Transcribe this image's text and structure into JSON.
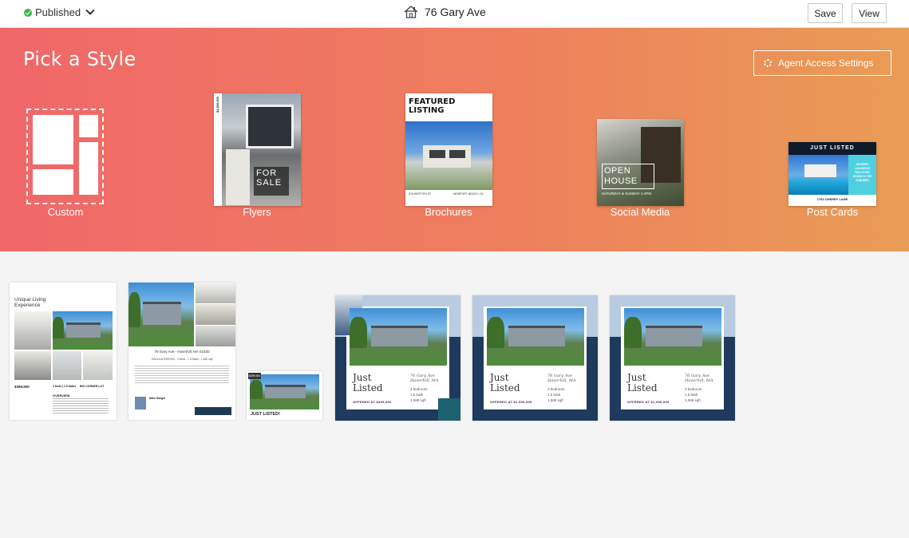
{
  "topbar": {
    "status": "Published",
    "title": "76 Gary Ave",
    "save_label": "Save",
    "view_label": "View"
  },
  "banner": {
    "heading": "Pick a Style",
    "agent_access_label": "Agent Access Settings",
    "styles": [
      {
        "label": "Custom"
      },
      {
        "label": "Flyers"
      },
      {
        "label": "Brochures"
      },
      {
        "label": "Social Media"
      },
      {
        "label": "Post Cards"
      }
    ],
    "flyer_thumb": {
      "price": "$1,500,000",
      "line1": "FOR",
      "line2": "SALE"
    },
    "brochure_thumb": {
      "line1": "FEATURED",
      "line2": "LISTING",
      "street": "415 WRITTEN ST",
      "city": "NEWPORT BEACH, CA"
    },
    "social_thumb": {
      "line1": "OPEN",
      "line2": "HOUSE",
      "date": "SATURDAY & SUNDAY 1-4PM"
    },
    "postcard_thumb": {
      "banner": "JUST LISTED",
      "side": "MODERN LUXURIOUS TWO-STORY HOUSE IN THE SUBURBS",
      "address": "1763 CHERRY LANE"
    }
  },
  "gallery": {
    "card1": {
      "title_line1": "Unique Living",
      "title_line2": "Experience",
      "price": "$399,900",
      "beds": "3 beds | 1.5 baths",
      "corner": "BIG CORNER LOT",
      "overview": "OVERVIEW"
    },
    "card2": {
      "address": "76 Gary Ave - Haverhill, MA 01830",
      "offer": "Offered at $399,900 - 3 Beds - 1.5 Baths - 1,588 sqft",
      "agent": "Mike Sanger"
    },
    "card3": {
      "caption": "JUST LISTED!",
      "badge": "$399,900"
    },
    "squares": [
      {
        "line1": "Just",
        "line2": "Listed",
        "address": "76 Gary Ave",
        "city": "Haverhill, MA",
        "b1": "3 bedroom",
        "b2": "1.5 bath",
        "b3": "1,588 sqft",
        "offer": "OFFERED AT $399,900"
      },
      {
        "line1": "Just",
        "line2": "Listed",
        "address": "76 Gary Ave",
        "city": "Haverhill, MA",
        "b1": "3 bedroom",
        "b2": "1.5 bath",
        "b3": "1,588 sqft",
        "offer": "OFFERED AT $1,999,999"
      },
      {
        "line1": "Just",
        "line2": "Listed",
        "address": "76 Gary Ave",
        "city": "Haverhill, MA",
        "b1": "3 bedroom",
        "b2": "1.5 bath",
        "b3": "1,588 sqft",
        "offer": "OFFERED AT $1,999,999"
      }
    ]
  },
  "colors": {
    "banner_start": "#f0676a",
    "banner_end": "#e99c55",
    "navy": "#1f3a5c",
    "published_green": "#3bb54a"
  }
}
